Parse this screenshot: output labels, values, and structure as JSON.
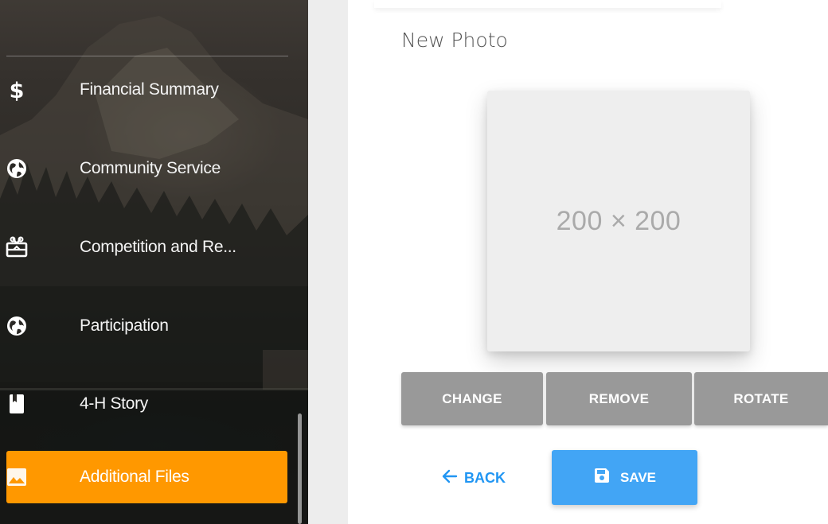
{
  "sidebar": {
    "items": [
      {
        "label": "Financial Summary",
        "icon": "dollar-icon"
      },
      {
        "label": "Community Service",
        "icon": "globe-icon"
      },
      {
        "label": "Competition and Re...",
        "icon": "award-icon"
      },
      {
        "label": "Participation",
        "icon": "globe-icon"
      },
      {
        "label": "4-H Story",
        "icon": "bookmark-icon"
      },
      {
        "label": "Additional Files",
        "icon": "image-icon",
        "active": true
      }
    ],
    "active_color": "#ff9800"
  },
  "main": {
    "title": "New Photo",
    "placeholder_text": "200 × 200",
    "buttons": {
      "change": "CHANGE",
      "remove": "REMOVE",
      "rotate": "ROTATE"
    },
    "back_label": "BACK",
    "save_label": "SAVE",
    "colors": {
      "gray_button": "#999999",
      "save_button": "#42a5f5",
      "link": "#2196f3"
    }
  }
}
